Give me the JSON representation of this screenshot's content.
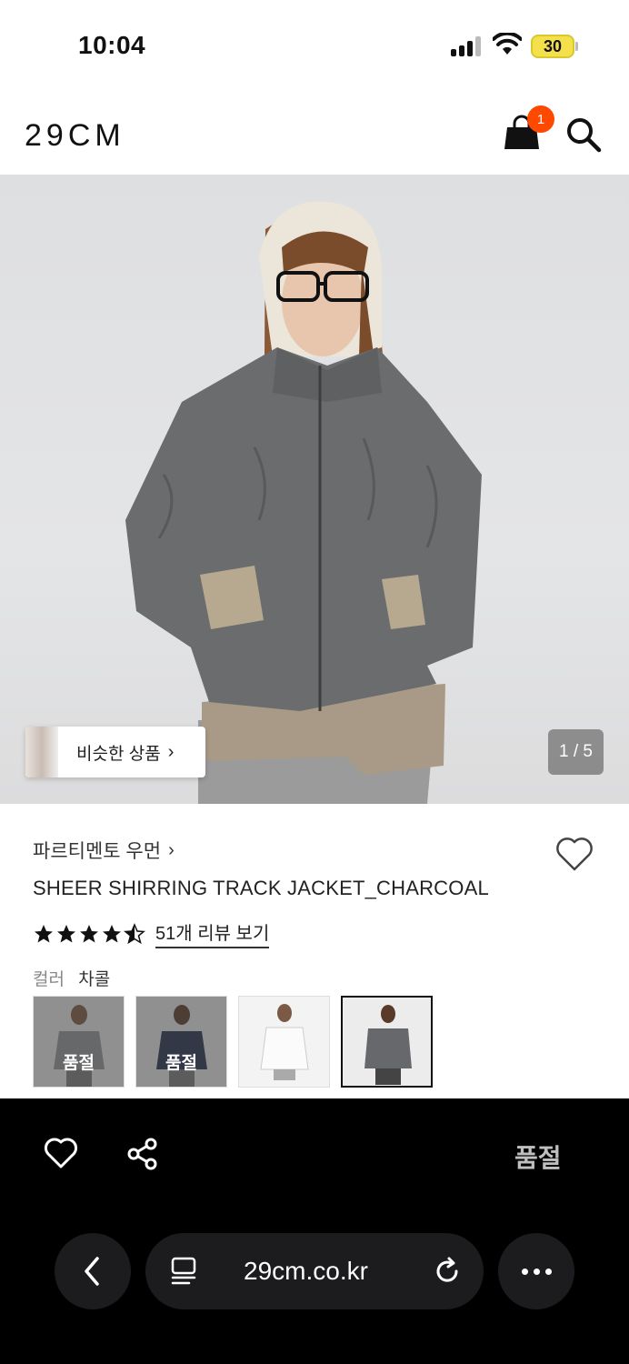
{
  "status_bar": {
    "time": "10:04",
    "battery": "30"
  },
  "header": {
    "logo": "29CM",
    "cart_count": "1",
    "icons": [
      "shopping-bag-icon",
      "search-icon"
    ]
  },
  "hero": {
    "similar_label": "비슷한 상품",
    "pager": "1 / 5"
  },
  "product": {
    "brand": "파르티멘토 우먼",
    "name": "SHEER SHIRRING TRACK JACKET_CHARCOAL",
    "rating": 4.5,
    "review_link": "51개 리뷰 보기",
    "color_label": "컬러",
    "color_value": "차콜",
    "swatches": [
      {
        "color_name": "gray",
        "soldout": "품절"
      },
      {
        "color_name": "navy",
        "soldout": "품절"
      },
      {
        "color_name": "white",
        "soldout": ""
      },
      {
        "color_name": "charcoal",
        "soldout": ""
      }
    ]
  },
  "action_bar": {
    "soldout_label": "품절"
  },
  "browser": {
    "url": "29cm.co.kr"
  },
  "colors": {
    "accent_badge": "#ff4800",
    "bar_bg": "#000000",
    "soldout_text": "#bfbfbf"
  }
}
